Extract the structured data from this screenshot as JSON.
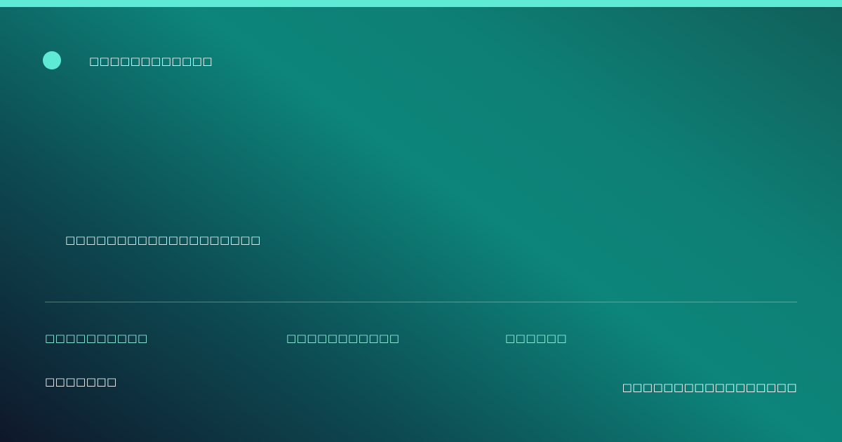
{
  "colors": {
    "accent": "#5eead4",
    "background_start": "#0f172a",
    "background_mid": "#0d857a",
    "background_end": "#115e59"
  },
  "brand": {
    "logo_icon": "circle-logo-icon",
    "name": "□□□□□□□□□□□□"
  },
  "tagline": "□□□□□□□□□□□□□□□□□□□",
  "meta": [
    "□□□□□□□□□□",
    "□□□□□□□□□□□",
    "□□□□□□"
  ],
  "footer": {
    "left": "□□□□□□□",
    "right": "□□□□□□□□□□□□□□□□□"
  }
}
